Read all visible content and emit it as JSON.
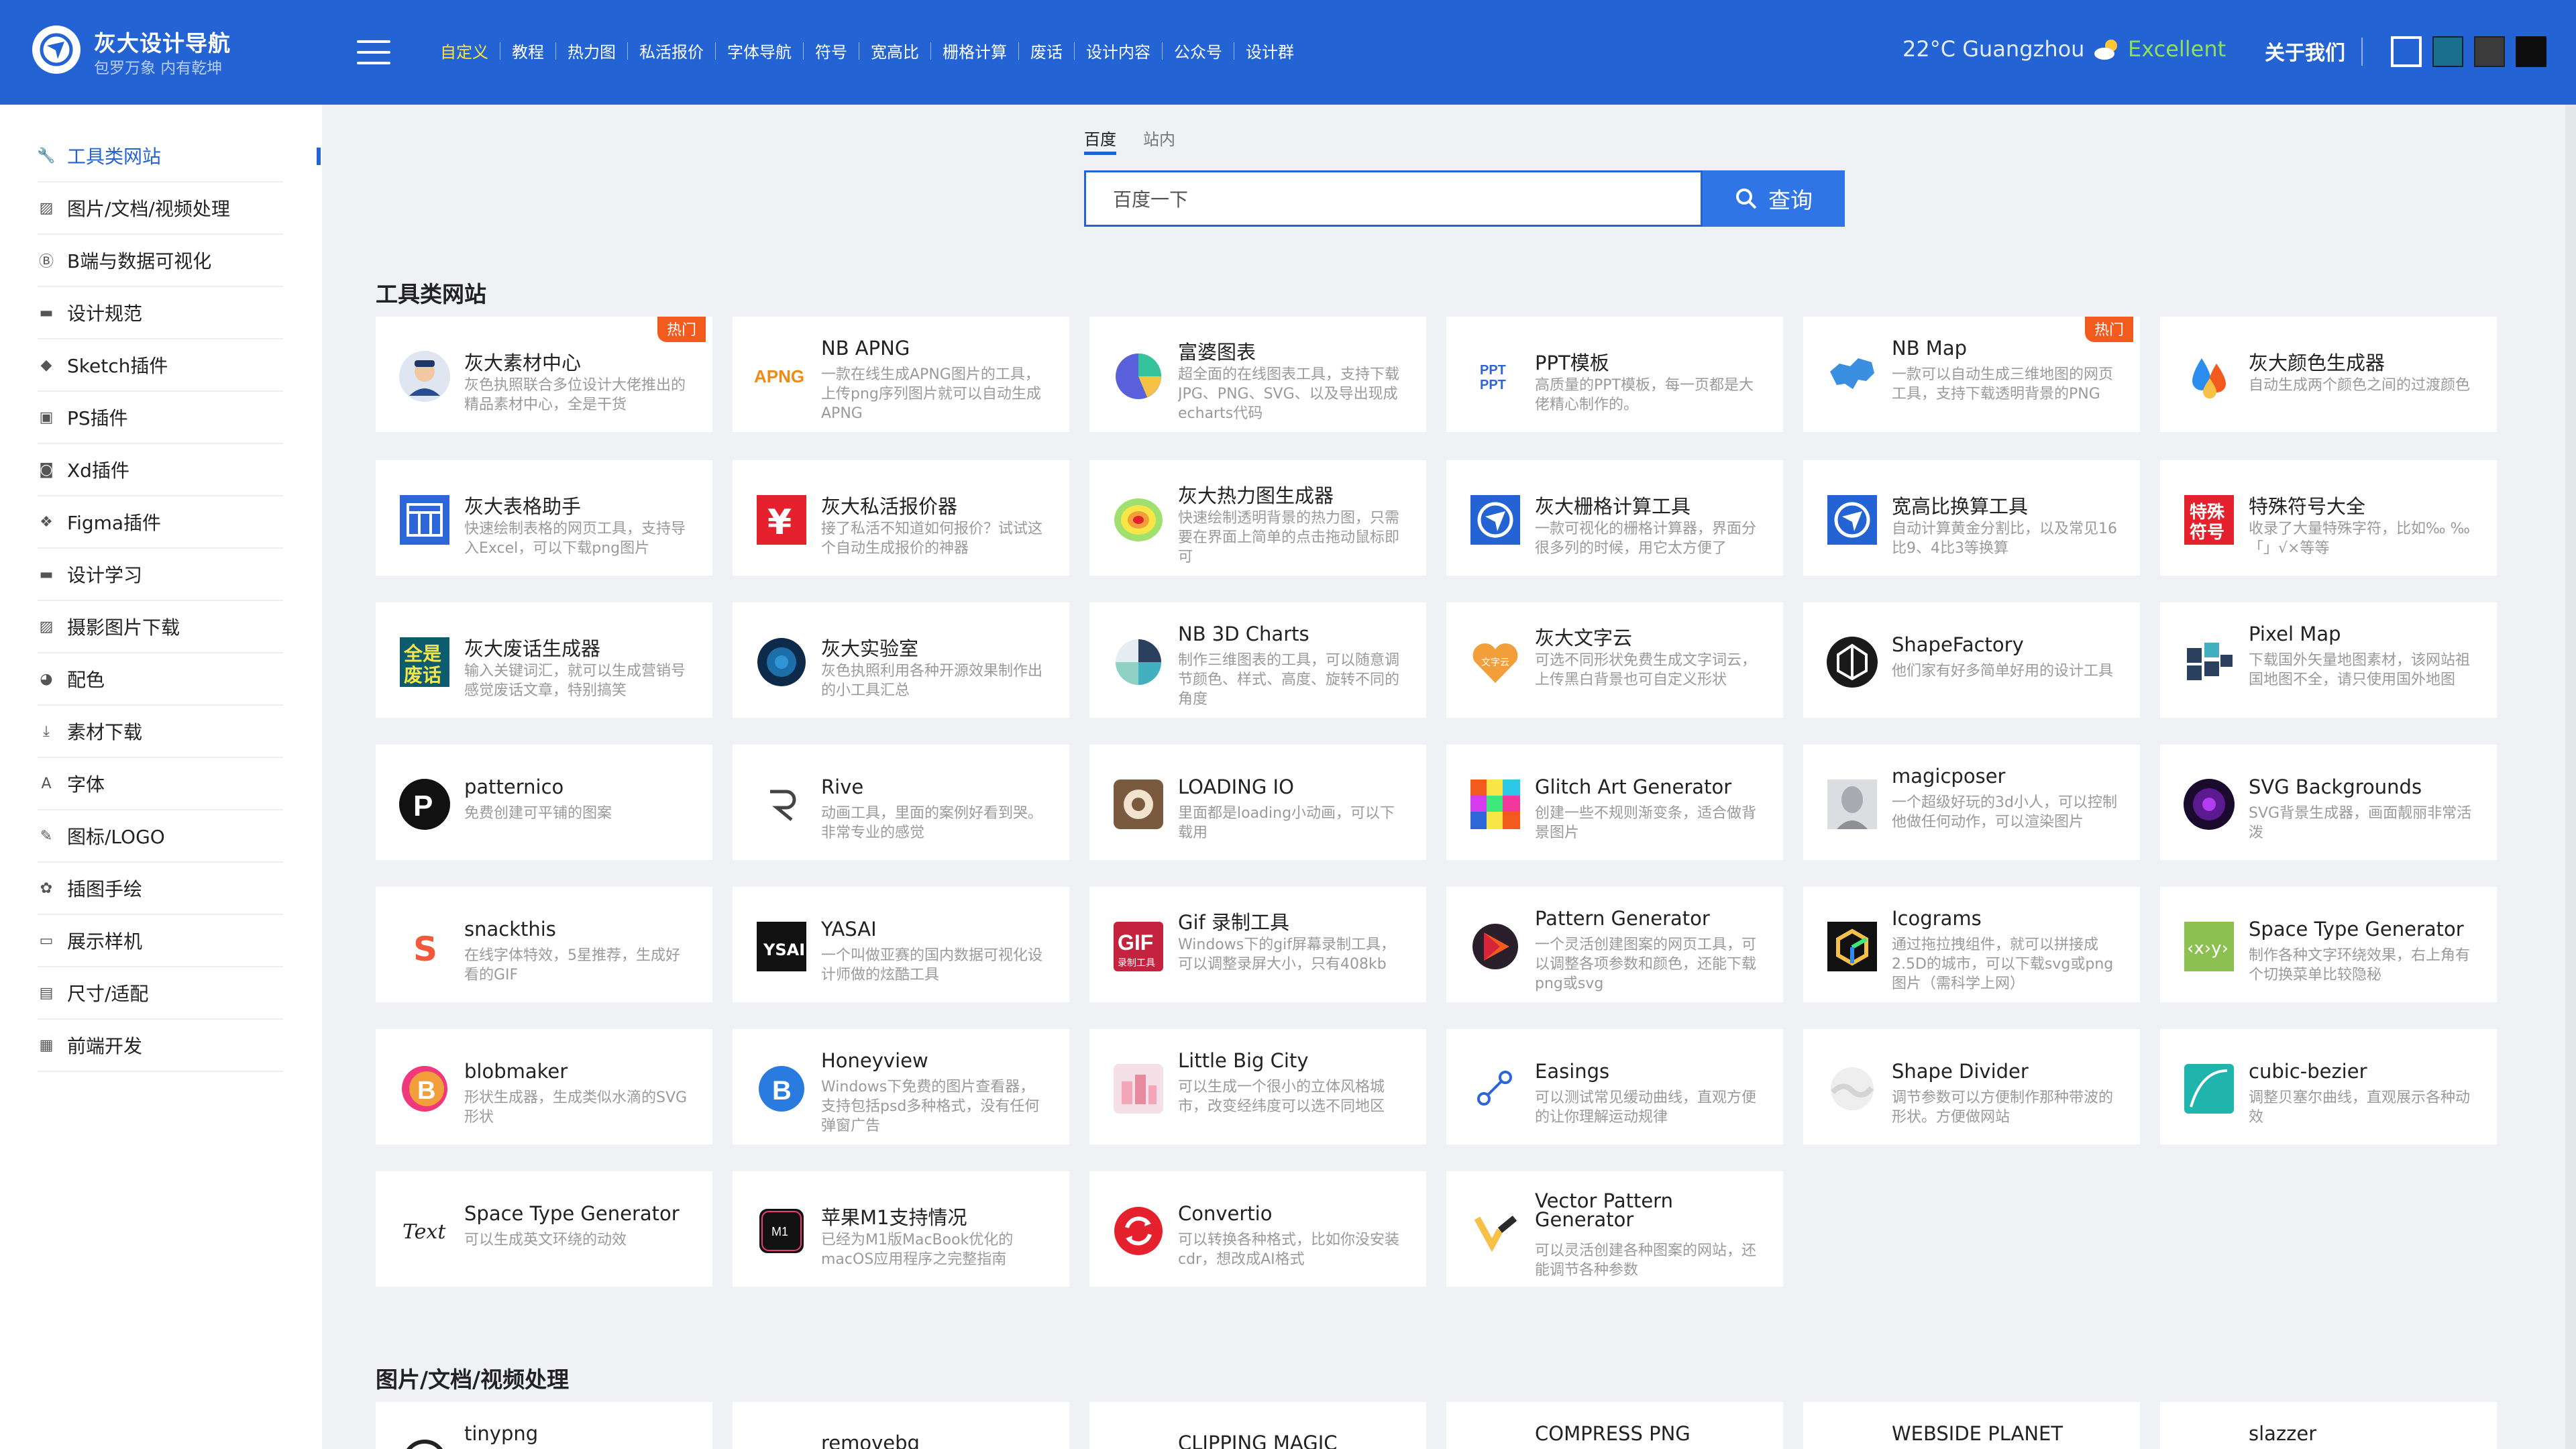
{
  "header": {
    "logo_title": "灰大设计导航",
    "logo_subtitle": "包罗万象 内有乾坤",
    "nav": [
      "自定义",
      "教程",
      "热力图",
      "私活报价",
      "字体导航",
      "符号",
      "宽高比",
      "栅格计算",
      "废话",
      "设计内容",
      "公众号",
      "设计群"
    ],
    "weather": "22°C Guangzhou",
    "air_quality": "Excellent",
    "about": "关于我们",
    "theme_swatches": [
      "#ffffff",
      "#1a6f8c",
      "#3b3b3b",
      "#0f0f0f"
    ]
  },
  "sidebar": {
    "items": [
      {
        "label": "工具类网站",
        "icon": "wrench-icon"
      },
      {
        "label": "图片/文档/视频处理",
        "icon": "image-icon"
      },
      {
        "label": "B端与数据可视化",
        "icon": "b-badge-icon"
      },
      {
        "label": "设计规范",
        "icon": "book-icon"
      },
      {
        "label": "Sketch插件",
        "icon": "diamond-icon"
      },
      {
        "label": "PS插件",
        "icon": "ps-icon"
      },
      {
        "label": "Xd插件",
        "icon": "xd-icon"
      },
      {
        "label": "Figma插件",
        "icon": "figma-icon"
      },
      {
        "label": "设计学习",
        "icon": "study-icon"
      },
      {
        "label": "摄影图片下载",
        "icon": "photo-icon"
      },
      {
        "label": "配色",
        "icon": "palette-icon"
      },
      {
        "label": "素材下载",
        "icon": "download-icon"
      },
      {
        "label": "字体",
        "icon": "font-icon"
      },
      {
        "label": "图标/LOGO",
        "icon": "brush-icon"
      },
      {
        "label": "插图手绘",
        "icon": "drawing-icon"
      },
      {
        "label": "展示样机",
        "icon": "mockup-icon"
      },
      {
        "label": "尺寸/适配",
        "icon": "ruler-icon"
      },
      {
        "label": "前端开发",
        "icon": "code-icon"
      }
    ]
  },
  "search": {
    "tabs": [
      "百度",
      "站内"
    ],
    "placeholder": "百度一下",
    "button": "查询"
  },
  "sections": [
    {
      "title": "工具类网站",
      "cards": [
        {
          "title": "灰大素材中心",
          "desc": "灰色执照联合多位设计大佬推出的精品素材中心，全是干货",
          "badge": "热门",
          "icon": "avatar-icon"
        },
        {
          "title": "NB APNG",
          "desc": "一款在线生成APNG图片的工具，上传png序列图片就可以自动生成APNG",
          "icon": "apng-icon"
        },
        {
          "title": "富婆图表",
          "desc": "超全面的在线图表工具，支持下载JPG、PNG、SVG、以及导出现成echarts代码",
          "icon": "pie-chart-icon"
        },
        {
          "title": "PPT模板",
          "desc": "高质量的PPT模板，每一页都是大佬精心制作的。",
          "icon": "ppt-icon"
        },
        {
          "title": "NB Map",
          "desc": "一款可以自动生成三维地图的网页工具，支持下载透明背景的PNG",
          "badge": "热门",
          "icon": "map-icon"
        },
        {
          "title": "灰大颜色生成器",
          "desc": "自动生成两个颜色之间的过渡颜色",
          "icon": "color-drop-icon"
        },
        {
          "title": "灰大表格助手",
          "desc": "快速绘制表格的网页工具，支持导入Excel，可以下载png图片",
          "icon": "table-icon"
        },
        {
          "title": "灰大私活报价器",
          "desc": "接了私活不知道如何报价？试试这个自动生成报价的神器",
          "icon": "yen-icon"
        },
        {
          "title": "灰大热力图生成器",
          "desc": "快速绘制透明背景的热力图，只需要在界面上简单的点击拖动鼠标即可",
          "icon": "heatmap-icon"
        },
        {
          "title": "灰大栅格计算工具",
          "desc": "一款可视化的栅格计算器，界面分很多列的时候，用它太方便了",
          "icon": "compass-icon"
        },
        {
          "title": "宽高比换算工具",
          "desc": "自动计算黄金分割比，以及常见16比9、4比3等换算",
          "icon": "compass-icon"
        },
        {
          "title": "特殊符号大全",
          "desc": "收录了大量特殊字符，比如‰ ‰「」√×等等",
          "icon": "symbol-icon"
        },
        {
          "title": "灰大废话生成器",
          "desc": "输入关键词汇，就可以生成营销号感觉废话文章，特别搞笑",
          "icon": "nonsense-icon"
        },
        {
          "title": "灰大实验室",
          "desc": "灰色执照利用各种开源效果制作出的小工具汇总",
          "icon": "lab-icon"
        },
        {
          "title": "NB 3D Charts",
          "desc": "制作三维图表的工具，可以随意调节颜色、样式、高度、旋转不同的角度",
          "icon": "3d-chart-icon"
        },
        {
          "title": "灰大文字云",
          "desc": "可选不同形状免费生成文字词云，上传黑白背景也可自定义形状",
          "icon": "heart-cloud-icon"
        },
        {
          "title": "ShapeFactory",
          "desc": "他们家有好多简单好用的设计工具",
          "icon": "shapefactory-icon"
        },
        {
          "title": "Pixel Map",
          "desc": "下载国外矢量地图素材，该网站祖国地图不全，请只使用国外地图",
          "icon": "pixel-map-icon"
        },
        {
          "title": "patternico",
          "desc": "免费创建可平铺的图案",
          "icon": "patternico-icon"
        },
        {
          "title": "Rive",
          "desc": "动画工具，里面的案例好看到哭。非常专业的感觉",
          "icon": "rive-icon"
        },
        {
          "title": "LOADING IO",
          "desc": "里面都是loading小动画，可以下载用",
          "icon": "loading-icon"
        },
        {
          "title": "Glitch Art Generator",
          "desc": "创建一些不规则渐变条，适合做背景图片",
          "icon": "glitch-icon"
        },
        {
          "title": "magicposer",
          "desc": "一个超级好玩的3d小人，可以控制他做任何动作，可以渲染图片",
          "icon": "poser-icon"
        },
        {
          "title": "SVG Backgrounds",
          "desc": "SVG背景生成器，画面靓丽非常活泼",
          "icon": "svg-bg-icon"
        },
        {
          "title": "snackthis",
          "desc": "在线字体特效，5星推荐，生成好看的GIF",
          "icon": "snackthis-icon"
        },
        {
          "title": "YASAI",
          "desc": "一个叫做亚赛的国内数据可视化设计师做的炫酷工具",
          "icon": "yasai-icon"
        },
        {
          "title": "Gif 录制工具",
          "desc": "Windows下的gif屏幕录制工具，可以调整录屏大小，只有408kb",
          "icon": "gif-icon"
        },
        {
          "title": "Pattern Generator",
          "desc": "一个灵活创建图案的网页工具，可以调整各项参数和颜色，还能下载png或svg",
          "icon": "pattern-icon"
        },
        {
          "title": "Icograms",
          "desc": "通过拖拉拽组件，就可以拼接成2.5D的城市，可以下载svg或png图片（需科学上网）",
          "icon": "icograms-icon"
        },
        {
          "title": "Space Type Generator",
          "desc": "制作各种文字环绕效果，右上角有个切换菜单比较隐秘",
          "icon": "space-type-icon"
        },
        {
          "title": "blobmaker",
          "desc": "形状生成器，生成类似水滴的SVG形状",
          "icon": "blob-icon"
        },
        {
          "title": "Honeyview",
          "desc": "Windows下免费的图片查看器，支持包括psd多种格式，没有任何弹窗广告",
          "icon": "honeyview-icon"
        },
        {
          "title": "Little Big City",
          "desc": "可以生成一个很小的立体风格城市，改变经纬度可以选不同地区",
          "icon": "city-icon"
        },
        {
          "title": "Easings",
          "desc": "可以测试常见缓动曲线，直观方便的让你理解运动规律",
          "icon": "easing-icon"
        },
        {
          "title": "Shape Divider",
          "desc": "调节参数可以方便制作那种带波的形状。方便做网站",
          "icon": "divider-icon"
        },
        {
          "title": "cubic-bezier",
          "desc": "调整贝塞尔曲线，直观展示各种动效",
          "icon": "bezier-icon"
        },
        {
          "title": "Space Type Generator",
          "desc": "可以生成英文环绕的动效",
          "icon": "text-icon"
        },
        {
          "title": "苹果M1支持情况",
          "desc": "已经为M1版MacBook优化的macOS应用程序之完整指南",
          "icon": "m1-icon"
        },
        {
          "title": "Convertio",
          "desc": "可以转换各种格式，比如你没安装cdr，想改成AI格式",
          "icon": "convertio-icon"
        },
        {
          "title": "Vector Pattern Generator",
          "desc": "可以灵活创建各种图案的网站，还能调节各种参数",
          "icon": "vector-pattern-icon"
        }
      ]
    },
    {
      "title": "图片/文档/视频处理",
      "cards": [
        {
          "title": "tinypng",
          "icon": "tinypng-icon"
        },
        {
          "title": "removebg",
          "icon": "removebg-icon"
        },
        {
          "title": "CLIPPING MAGIC",
          "icon": "clipping-icon"
        },
        {
          "title": "COMPRESS PNG",
          "icon": "compress-icon"
        },
        {
          "title": "WEBSIDE PLANET",
          "icon": "planet-icon"
        },
        {
          "title": "slazzer",
          "icon": "slazzer-icon"
        }
      ]
    }
  ]
}
